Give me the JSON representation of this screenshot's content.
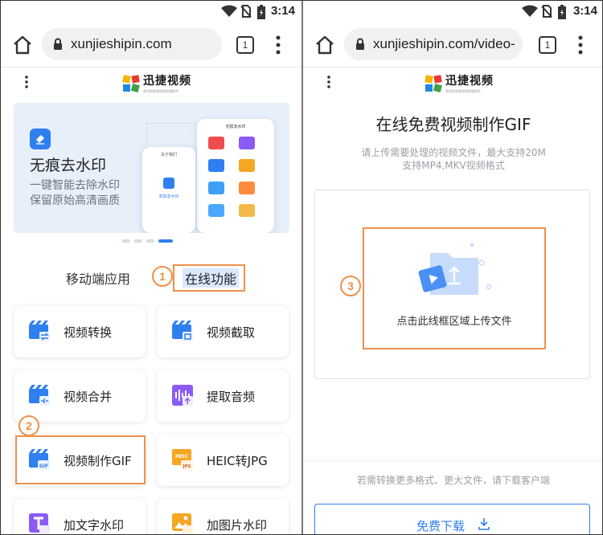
{
  "left": {
    "status": {
      "time": "3:14"
    },
    "browser": {
      "url": "xunjieshipin.com",
      "tab_count": "1"
    },
    "logo": {
      "name": "迅捷视频",
      "tagline": "易用的视频转换剪辑软件"
    },
    "banner": {
      "title": "无痕去水印",
      "subtitle_line1": "一键智能去除水印",
      "subtitle_line2": "保留原始高清画质",
      "phone_back_title": "无损去水印",
      "phone_front_title": "关于我们",
      "phone_front_label": "去除去水印"
    },
    "carousel": {
      "count": 4,
      "active_index": 3
    },
    "tabs": {
      "mobile": "移动端应用",
      "online": "在线功能"
    },
    "features": [
      {
        "label": "视频转换",
        "icon": "video-convert-icon"
      },
      {
        "label": "视频截取",
        "icon": "video-clip-icon"
      },
      {
        "label": "视频合并",
        "icon": "video-merge-icon"
      },
      {
        "label": "提取音频",
        "icon": "audio-extract-icon"
      },
      {
        "label": "视频制作GIF",
        "icon": "video-gif-icon",
        "badge": "GIF"
      },
      {
        "label": "HEIC转JPG",
        "icon": "heic-jpg-icon",
        "badge_top": "HEIC",
        "badge_bottom": "JPG"
      },
      {
        "label": "加文字水印",
        "icon": "text-watermark-icon"
      },
      {
        "label": "加图片水印",
        "icon": "image-watermark-icon"
      }
    ],
    "markers": {
      "m1": "1",
      "m2": "2"
    }
  },
  "right": {
    "status": {
      "time": "3:14"
    },
    "browser": {
      "url": "xunjieshipin.com/video-",
      "tab_count": "1"
    },
    "logo": {
      "name": "迅捷视频",
      "tagline": "易用的视频转换剪辑软件"
    },
    "title": "在线免费视频制作GIF",
    "subtitle_line1": "请上传需要处理的视频文件，最大支持20M",
    "subtitle_line2": "支持MP4,MKV视频格式",
    "upload_text": "点击此线框区域上传文件",
    "footnote": "若需转换更多格式、更大文件，请下载客户端",
    "download_label": "免费下载",
    "markers": {
      "m3": "3"
    }
  },
  "colors": {
    "accent": "#2f7ff0",
    "annotation": "#f0904a"
  }
}
